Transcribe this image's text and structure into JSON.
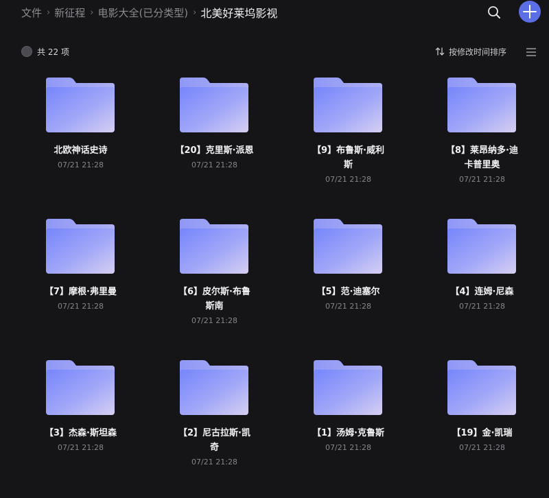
{
  "breadcrumb": [
    {
      "label": "文件"
    },
    {
      "label": "新征程"
    },
    {
      "label": "电影大全(已分类型)"
    },
    {
      "label": "北美好莱坞影视"
    }
  ],
  "toolbar": {
    "count_label": "共 22 项",
    "sort_label": "按修改时间排序"
  },
  "items": [
    {
      "name": "北欧神话史诗",
      "date": "07/21 21:28"
    },
    {
      "name": "【20】克里斯·派恩",
      "date": "07/21 21:28"
    },
    {
      "name": "【9】布鲁斯·威利斯",
      "date": "07/21 21:28"
    },
    {
      "name": "【8】莱昂纳多·迪卡普里奥",
      "date": "07/21 21:28"
    },
    {
      "name": "【7】摩根·弗里曼",
      "date": "07/21 21:28"
    },
    {
      "name": "【6】皮尔斯·布鲁斯南",
      "date": "07/21 21:28"
    },
    {
      "name": "【5】范·迪塞尔",
      "date": "07/21 21:28"
    },
    {
      "name": "【4】连姆·尼森",
      "date": "07/21 21:28"
    },
    {
      "name": "【3】杰森·斯坦森",
      "date": "07/21 21:28"
    },
    {
      "name": "【2】尼古拉斯·凯奇",
      "date": "07/21 21:28"
    },
    {
      "name": "【1】汤姆·克鲁斯",
      "date": "07/21 21:28"
    },
    {
      "name": "【19】金·凯瑞",
      "date": "07/21 21:28"
    }
  ],
  "icons": {
    "search": "search-icon",
    "add": "plus-icon",
    "sort": "sort-arrows-icon",
    "list": "list-view-icon",
    "folder": "folder-icon"
  },
  "colors": {
    "background": "#151518",
    "accent": "#5b6ee6",
    "folder_front_start": "#7b8bfb",
    "folder_front_end": "#c9c5f3",
    "folder_back": "#9aa2f4"
  }
}
